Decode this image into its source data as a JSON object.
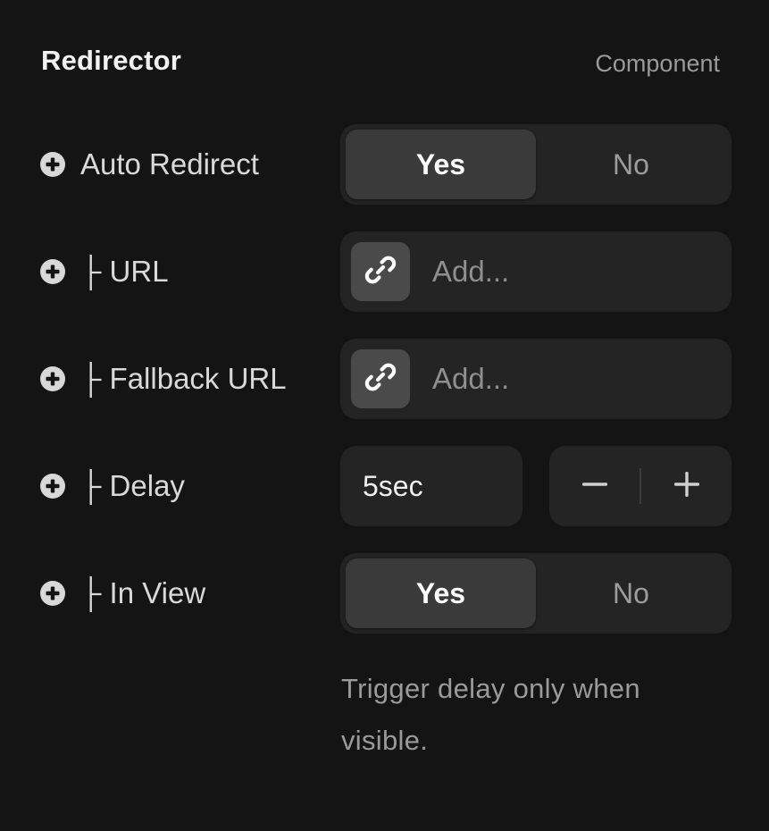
{
  "header": {
    "title": "Redirector",
    "subtitle": "Component"
  },
  "rows": {
    "auto_redirect": {
      "label": "Auto Redirect",
      "options": [
        "Yes",
        "No"
      ],
      "selected": "Yes"
    },
    "url": {
      "label": "├ URL",
      "placeholder": "Add..."
    },
    "fallback_url": {
      "label": "├ Fallback URL",
      "placeholder": "Add..."
    },
    "delay": {
      "label": "├ Delay",
      "value": "5sec"
    },
    "in_view": {
      "label": "├ In View",
      "options": [
        "Yes",
        "No"
      ],
      "selected": "Yes"
    }
  },
  "helper_text": "Trigger delay only when visible.",
  "icons": {
    "row_add": "plus-circle-icon",
    "link": "link-icon",
    "decrement": "minus-icon",
    "increment": "plus-icon"
  },
  "colors": {
    "background": "#141414",
    "control_bg": "#242424",
    "active_segment": "#3a3a3a",
    "link_button": "#4a4a4a",
    "muted_text": "#9a9a9a"
  }
}
